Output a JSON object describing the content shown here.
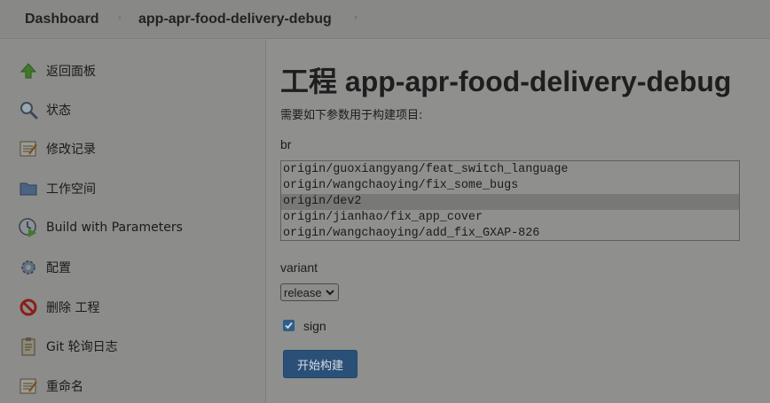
{
  "breadcrumb": {
    "items": [
      "Dashboard",
      "app-apr-food-delivery-debug"
    ],
    "separator": "›"
  },
  "sidebar": {
    "items": [
      {
        "label": "返回面板",
        "icon": "up-arrow-icon"
      },
      {
        "label": "状态",
        "icon": "magnifier-icon"
      },
      {
        "label": "修改记录",
        "icon": "notepad-icon"
      },
      {
        "label": "工作空间",
        "icon": "folder-icon"
      },
      {
        "label": "Build with Parameters",
        "icon": "clock-play-icon"
      },
      {
        "label": "配置",
        "icon": "gear-icon"
      },
      {
        "label": "删除 工程",
        "icon": "no-entry-icon"
      },
      {
        "label": "Git 轮询日志",
        "icon": "clipboard-icon"
      },
      {
        "label": "重命名",
        "icon": "notepad-icon"
      }
    ]
  },
  "main": {
    "title": "工程 app-apr-food-delivery-debug",
    "subtitle": "需要如下参数用于构建项目:",
    "br": {
      "label": "br",
      "options": [
        "origin/guoxiangyang/feat_switch_language",
        "origin/wangchaoying/fix_some_bugs",
        "origin/dev2",
        "origin/jianhao/fix_app_cover",
        "origin/wangchaoying/add_fix_GXAP-826"
      ],
      "selected_index": 2
    },
    "variant": {
      "label": "variant",
      "selected": "release"
    },
    "sign": {
      "label": "sign",
      "checked": true
    },
    "submit_label": "开始构建"
  },
  "colors": {
    "overlay_bg": "#8f8f8d",
    "button": "#2a5078",
    "checkbox": "#2f5e8a",
    "selected_row": "#787876"
  }
}
